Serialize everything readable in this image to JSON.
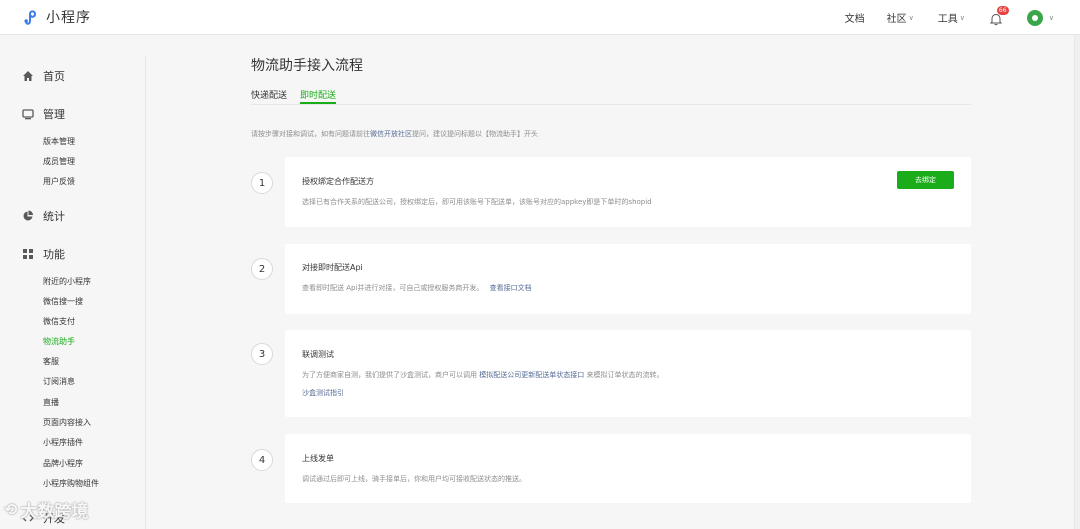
{
  "header": {
    "app_name": "小程序",
    "docs": "文档",
    "community": "社区",
    "tools": "工具",
    "notification_count": "66"
  },
  "sidebar": {
    "home": "首页",
    "manage": "管理",
    "manage_items": [
      "版本管理",
      "成员管理",
      "用户反馈"
    ],
    "stats": "统计",
    "features": "功能",
    "feature_items": [
      "附近的小程序",
      "微信搜一搜",
      "微信支付",
      "物流助手",
      "客服",
      "订阅消息",
      "直播",
      "页面内容接入",
      "小程序插件",
      "品牌小程序",
      "小程序购物组件"
    ],
    "develop": "开发"
  },
  "main": {
    "title": "物流助手接入流程",
    "tabs": [
      "快递配送",
      "即时配送"
    ],
    "intro_prefix": "请按步骤对接和调试，如有问题请前往",
    "intro_link": "微信开放社区",
    "intro_suffix": "提问，建议提问标题以【物流助手】开头",
    "steps": [
      {
        "num": "1",
        "title": "授权绑定合作配送方",
        "desc": "选择已有合作关系的配送公司，授权绑定后，即可用该账号下配送单，该账号对应的appkey即是下单时的shopid",
        "button": "去绑定"
      },
      {
        "num": "2",
        "title": "对接即时配送Api",
        "desc": "查看即时配送 Api并进行对接，可自己或授权服务商开发。",
        "link": "查看接口文档"
      },
      {
        "num": "3",
        "title": "联调测试",
        "desc_prefix": "为了方便商家自测，我们提供了沙盒测试，商户可以调用",
        "desc_link": "模拟配送公司更新配送单状态接口",
        "desc_suffix": "来模拟订单状态的流转。",
        "link": "沙盒测试指引"
      },
      {
        "num": "4",
        "title": "上线发单",
        "desc": "调试通过后即可上线，骑手接单后，你和用户均可接收配送状态的推送。"
      }
    ]
  },
  "watermark": "大数跨境",
  "colors": {
    "accent": "#1aad19",
    "link": "#576b95",
    "badge": "#e64340"
  }
}
